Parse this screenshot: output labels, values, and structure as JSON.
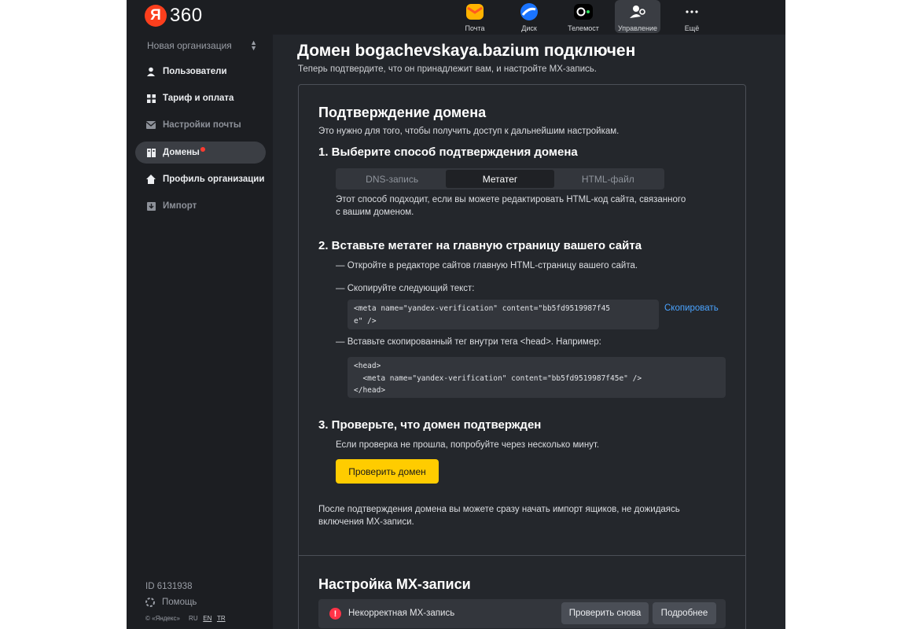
{
  "colors": {
    "accent_yellow": "#ffcc00",
    "link_blue": "#4aa3ff",
    "alert_red": "#ff3347",
    "brand_red": "#fc3f1d",
    "background": "#23262b",
    "sidebar_bg": "#1c1e22"
  },
  "brand": {
    "logo_letter": "Я",
    "logo_number": "360"
  },
  "topnav": [
    {
      "label": "Почта",
      "icon": "mail-icon"
    },
    {
      "label": "Диск",
      "icon": "disk-icon"
    },
    {
      "label": "Телемост",
      "icon": "telemost-icon"
    },
    {
      "label": "Управление",
      "icon": "admin-icon",
      "active": true
    },
    {
      "label": "Ещё",
      "icon": "more-icon"
    }
  ],
  "sidebar": {
    "org_name": "Новая организация",
    "items": [
      {
        "label": "Пользователи",
        "icon": "user-icon"
      },
      {
        "label": "Тариф и оплата",
        "icon": "grid-icon"
      },
      {
        "label": "Настройки почты",
        "icon": "envelope-icon",
        "dim": true
      },
      {
        "label": "Домены",
        "icon": "domains-icon",
        "active": true,
        "notification_dot": true
      },
      {
        "label": "Профиль организации",
        "icon": "home-icon"
      },
      {
        "label": "Импорт",
        "icon": "import-icon",
        "dim": true
      }
    ],
    "footer": {
      "id_text": "ID 6131938",
      "help_label": "Помощь",
      "copyright": "© «Яндекс»",
      "languages": [
        "RU",
        "EN",
        "TR"
      ]
    }
  },
  "page": {
    "title": "Домен bogachevskaya.bazium подключен",
    "subtitle": "Теперь подтвердите, что он принадлежит вам, и настройте MX-запись."
  },
  "verification": {
    "heading": "Подтверждение домена",
    "intro": "Это нужно для того, чтобы получить доступ к дальнейшим настройкам.",
    "step1": {
      "title": "1.  Выберите способ подтверждения домена",
      "tabs": [
        "DNS-запись",
        "Метатег",
        "HTML-файл"
      ],
      "active_tab": "Метатег",
      "description_line1": "Этот способ подходит, если вы можете редактировать HTML-код сайта, связанного",
      "description_line2": "с вашим доменом."
    },
    "step2": {
      "title": "2.  Вставьте метатег на главную страницу вашего сайта",
      "instruction1": "— Откройте в редакторе сайтов главную HTML-страницу вашего сайта.",
      "instruction2": "— Скопируйте следующий текст:",
      "meta_code": "<meta name=\"yandex-verification\" content=\"bb5fd9519987f45\ne\" />",
      "copy_label": "Скопировать",
      "instruction3": "— Вставьте скопированный тег внутри тега <head>. Например:",
      "example_code": "<head>\n  <meta name=\"yandex-verification\" content=\"bb5fd9519987f45e\" />\n</head>"
    },
    "step3": {
      "title": "3.  Проверьте, что домен подтвержден",
      "hint": "Если проверка не прошла, попробуйте через несколько минут.",
      "button": "Проверить домен"
    },
    "after_note_line1": "После подтверждения домена вы можете сразу начать импорт ящиков, не дожидаясь",
    "after_note_line2": "включения MX-записи."
  },
  "mx": {
    "heading": "Настройка MX-записи",
    "alert_icon": "alert-icon",
    "alert_text": "Некорректная MX-запись",
    "recheck_button": "Проверить снова",
    "details_button": "Подробнее"
  }
}
